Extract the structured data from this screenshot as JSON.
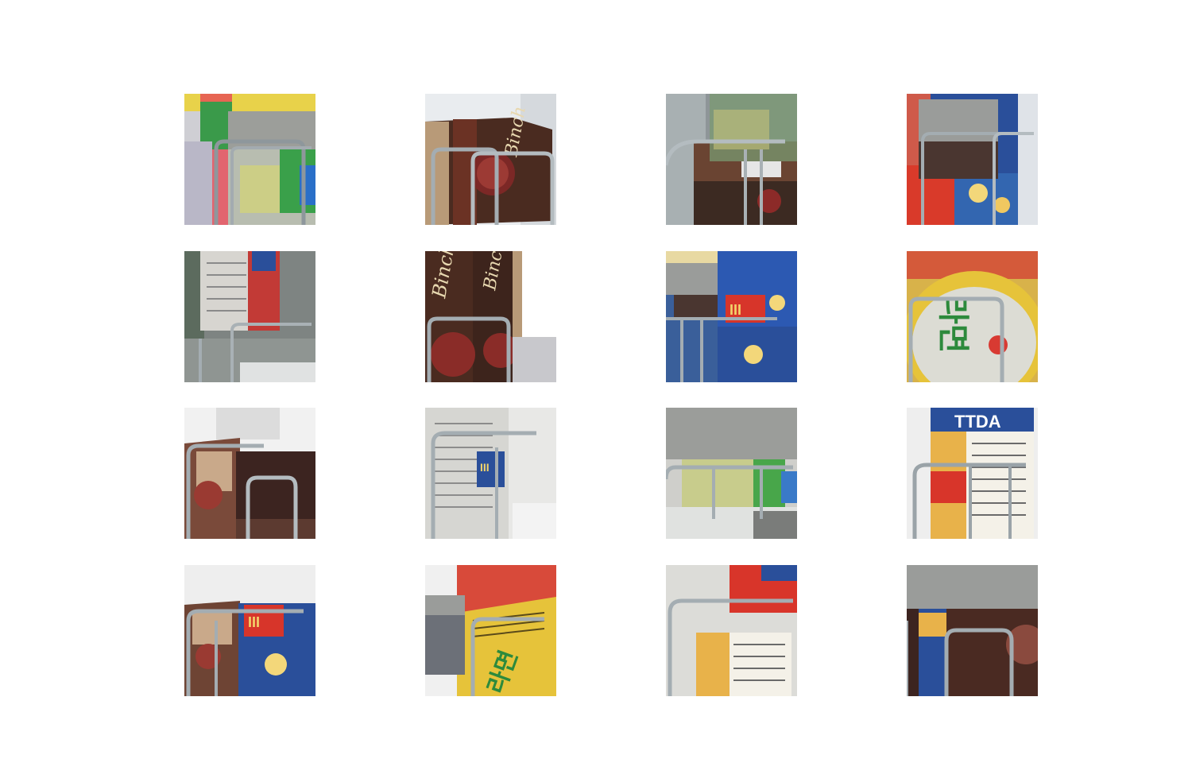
{
  "figure": {
    "layout": "4x4 grid of augmented image crops",
    "tiles": [
      {
        "id": "r1c1",
        "subject": "green-label snack package with gray mask patch"
      },
      {
        "id": "r1c2",
        "subject": "Binch cookie box on wire rack"
      },
      {
        "id": "r1c3",
        "subject": "stacked cookie boxes with translucent overlay"
      },
      {
        "id": "r1c4",
        "subject": "popcorn box with gray mask patch"
      },
      {
        "id": "r2c1",
        "subject": "empty shelf with nutrition-label patch"
      },
      {
        "id": "r2c2",
        "subject": "Binch box close-up"
      },
      {
        "id": "r2c3",
        "subject": "blue popcorn box with pasted patch"
      },
      {
        "id": "r2c4",
        "subject": "round noodle cup lid, green lettering"
      },
      {
        "id": "r3c1",
        "subject": "cookie box edge with dark box patch"
      },
      {
        "id": "r3c2",
        "subject": "nutrition label box with small popcorn patch"
      },
      {
        "id": "r3c3",
        "subject": "blurred green snack with gray mask"
      },
      {
        "id": "r3c4",
        "subject": "popcorn box nutrition facts panel"
      },
      {
        "id": "r4c1",
        "subject": "cookie box with blue popcorn patch"
      },
      {
        "id": "r4c2",
        "subject": "yellow noodle cup with gray patch"
      },
      {
        "id": "r4c3",
        "subject": "nutrition label with popcorn patch"
      },
      {
        "id": "r4c4",
        "subject": "dark box with gray top mask"
      }
    ]
  },
  "colors": {
    "background": "#ffffff",
    "mask_gray": "#9a9c9a",
    "rack_steel": "#9aa3a8",
    "chocolate": "#4a2a1e",
    "popcorn_blue": "#1f4e9c",
    "snack_green": "#2d8a3c",
    "snack_yellow": "#e6c83a"
  }
}
